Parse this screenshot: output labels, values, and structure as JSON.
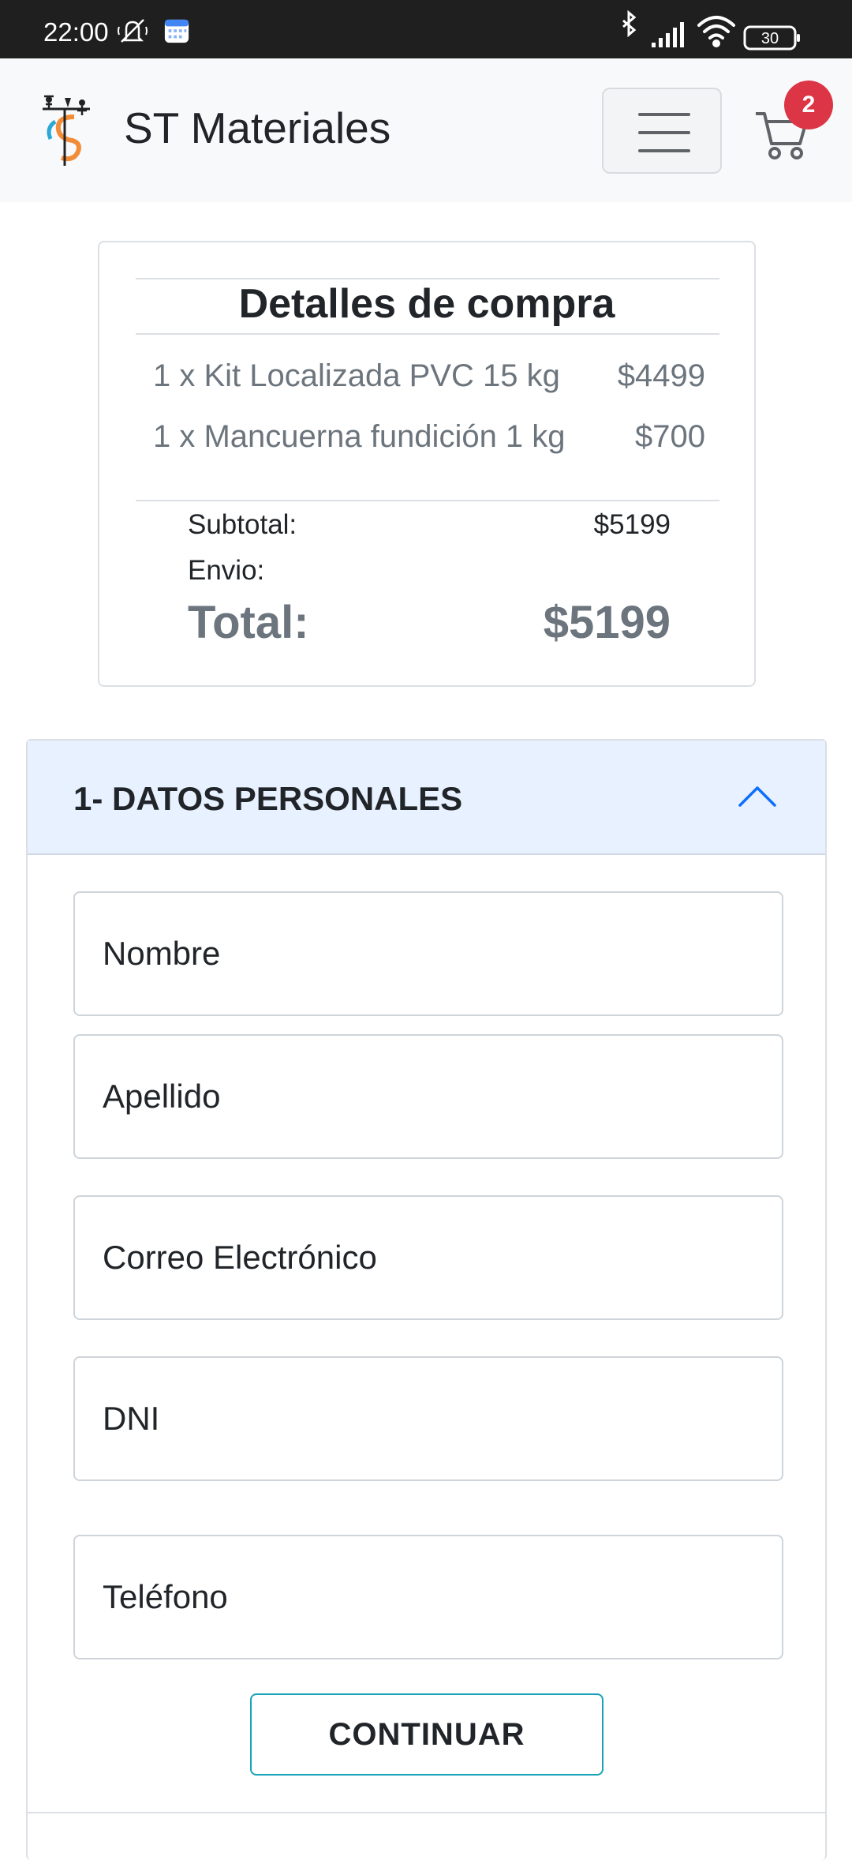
{
  "status_bar": {
    "time": "22:00",
    "battery": "30",
    "icons": [
      "silent-mode-icon",
      "calendar-icon",
      "bluetooth-icon",
      "signal-icon",
      "wifi-icon",
      "battery-icon"
    ]
  },
  "navbar": {
    "brand_name": "ST Materiales",
    "logo_icon": "st-materiales-logo",
    "menu_icon": "hamburger-menu-icon",
    "cart_icon": "shopping-cart-icon",
    "cart_count": "2",
    "colors": {
      "background": "#f8f9fa",
      "badge": "#dc3545"
    }
  },
  "summary": {
    "title": "Detalles de compra",
    "items": [
      {
        "label": "1 x Kit Localizada PVC 15 kg",
        "price": "$4499"
      },
      {
        "label": "1 x Mancuerna fundición 1 kg",
        "price": "$700"
      }
    ],
    "subtotal_label": "Subtotal:",
    "subtotal_value": "$5199",
    "shipping_label": "Envio:",
    "shipping_value": "",
    "total_label": "Total:",
    "total_value": "$5199"
  },
  "checkout": {
    "section_title": "1- DATOS PERSONALES",
    "section_expanded": true,
    "chevron_icon": "chevron-up-icon",
    "fields": {
      "nombre": {
        "placeholder": "Nombre",
        "value": ""
      },
      "apellido": {
        "placeholder": "Apellido",
        "value": ""
      },
      "email": {
        "placeholder": "Correo Electrónico",
        "value": ""
      },
      "dni": {
        "placeholder": "DNI",
        "value": ""
      },
      "telefono": {
        "placeholder": "Teléfono",
        "value": ""
      }
    },
    "continue_label": "CONTINUAR",
    "colors": {
      "header_bg": "#e7f1ff",
      "accent": "#0d6efd",
      "button_border": "#17a2b8"
    }
  }
}
